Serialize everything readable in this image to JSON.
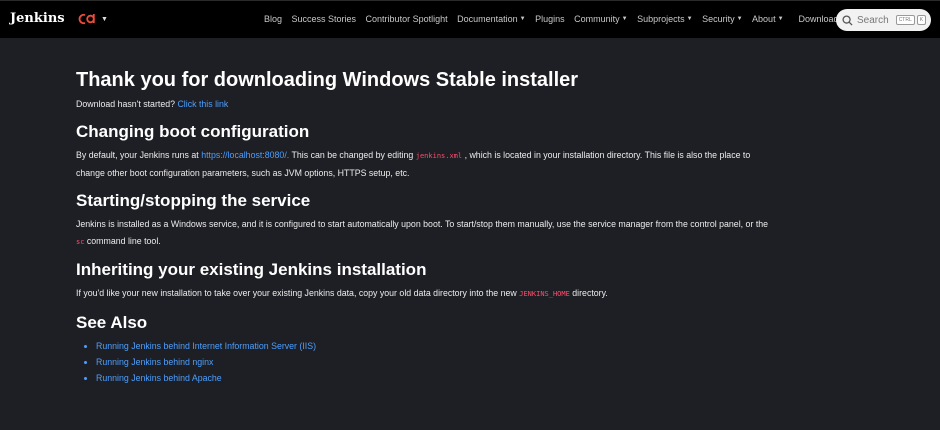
{
  "header": {
    "brand": "Jenkins",
    "cd_logo": "cd",
    "nav": [
      {
        "label": "Blog",
        "dropdown": false
      },
      {
        "label": "Success Stories",
        "dropdown": false
      },
      {
        "label": "Contributor Spotlight",
        "dropdown": false
      },
      {
        "label": "Documentation",
        "dropdown": true
      },
      {
        "label": "Plugins",
        "dropdown": false
      },
      {
        "label": "Community",
        "dropdown": true
      },
      {
        "label": "Subprojects",
        "dropdown": true
      },
      {
        "label": "Security",
        "dropdown": true
      },
      {
        "label": "About",
        "dropdown": true
      },
      {
        "label": "Download",
        "dropdown": false
      }
    ],
    "search": {
      "placeholder": "Search",
      "key1": "CTRL",
      "key2": "K"
    }
  },
  "main": {
    "title": "Thank you for downloading Windows Stable installer",
    "download_prompt": "Download hasn't started?",
    "download_link": "Click this link",
    "sections": {
      "boot": {
        "heading": "Changing boot configuration",
        "text1": "By default, your Jenkins runs at",
        "link": "https://localhost:8080/.",
        "text2": "This can be changed by editing",
        "code": "jenkins.xml",
        "text3": ", which is located in your installation directory. This file is also the place to",
        "text4": "change other boot configuration parameters, such as JVM options, HTTPS setup, etc."
      },
      "service": {
        "heading": "Starting/stopping the service",
        "text1": "Jenkins is installed as a Windows service, and it is configured to start automatically upon boot. To start/stop them manually, use the service manager from the control panel, or the",
        "code": "sc",
        "text2": "command line tool."
      },
      "inherit": {
        "heading": "Inheriting your existing Jenkins installation",
        "text1": "If you'd like your new installation to take over your existing Jenkins data, copy your old data directory into the new",
        "code": "JENKINS_HOME",
        "text2": "directory."
      },
      "see_also": {
        "heading": "See Also",
        "links": [
          "Running Jenkins behind Internet Information Server (IIS)",
          "Running Jenkins behind nginx",
          "Running Jenkins behind Apache"
        ]
      }
    }
  },
  "colors": {
    "background": "#1e1f24",
    "topbar": "#000000",
    "link": "#4c9fff",
    "code": "#ff4d6d",
    "cd_logo": "#ef4b3a"
  }
}
